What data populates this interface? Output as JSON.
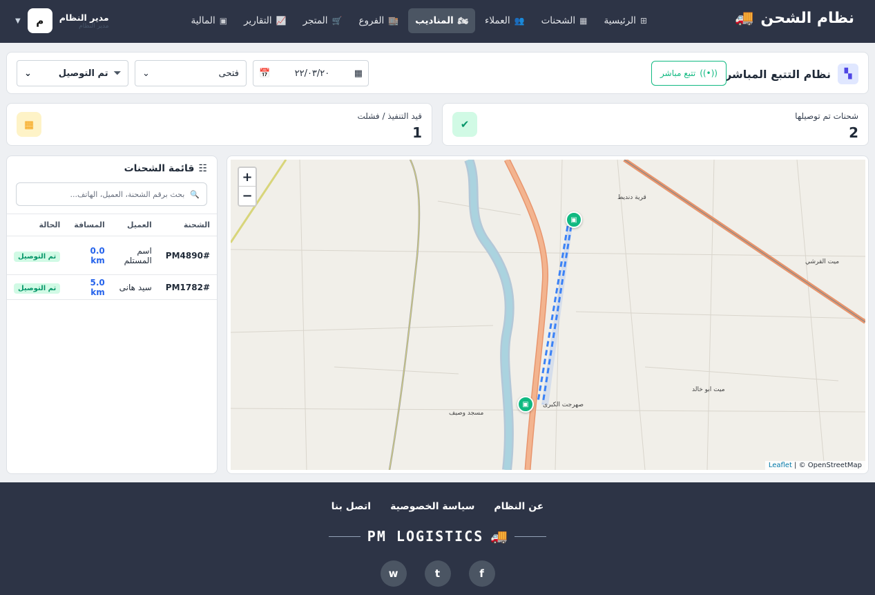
{
  "nav": {
    "brand": "نظام الشحن",
    "items": [
      {
        "label": "الرئيسية",
        "icon": "⊞"
      },
      {
        "label": "الشحنات",
        "icon": "▦"
      },
      {
        "label": "العملاء",
        "icon": "👥"
      },
      {
        "label": "المناديب",
        "icon": "🏍"
      },
      {
        "label": "الفروع",
        "icon": "🏬"
      },
      {
        "label": "المتجر",
        "icon": "🛒"
      },
      {
        "label": "التقارير",
        "icon": "📈"
      },
      {
        "label": "المالية",
        "icon": "▣"
      }
    ],
    "active_index": 3,
    "user": {
      "name": "مدير النظام",
      "role": "مدير النظام",
      "avatar": "م"
    }
  },
  "toolbar": {
    "title": "نظام التتبع المباشر",
    "live_button": "تتبع مباشر",
    "date_value": "٢٢/٠٣/٢٠",
    "driver_select": "فتحى",
    "status_select": "تم التوصيل"
  },
  "stats": [
    {
      "label": "شحنات تم توصيلها",
      "value": "2"
    },
    {
      "label": "قيد التنفيذ / فشلت",
      "value": "1"
    }
  ],
  "shipments": {
    "title": "قائمة الشحنات",
    "search_placeholder": "بحث برقم الشحنة، العميل، الهاتف...",
    "columns": [
      "الشحنة",
      "العميل",
      "المسافة",
      "الحالة"
    ],
    "rows": [
      {
        "id": "#PM4890",
        "customer": "اسم المستلم",
        "distance": "0.0 km",
        "status": "تم التوصيل"
      },
      {
        "id": "#PM1782",
        "customer": "سيد هانى",
        "distance": "5.0 km",
        "status": "تم التوصيل"
      }
    ]
  },
  "map": {
    "zoom_in": "+",
    "zoom_out": "−",
    "attribution_leaflet": "Leaflet",
    "attribution_osm": "© OpenStreetMap",
    "places": [
      "قرية دنديط",
      "ميت القرشي",
      "ميت ابو خالد",
      "صهرجت الكبرى",
      "مسجد وصيف"
    ]
  },
  "footer": {
    "links": [
      "عن النظام",
      "سياسة الخصوصية",
      "اتصل بنا"
    ],
    "logo": "PM LOGISTICS",
    "social": [
      "f",
      "t",
      "w"
    ]
  },
  "colors": {
    "nav": "#2d3446",
    "accent": "#10b981",
    "route": "#3b82f6"
  }
}
